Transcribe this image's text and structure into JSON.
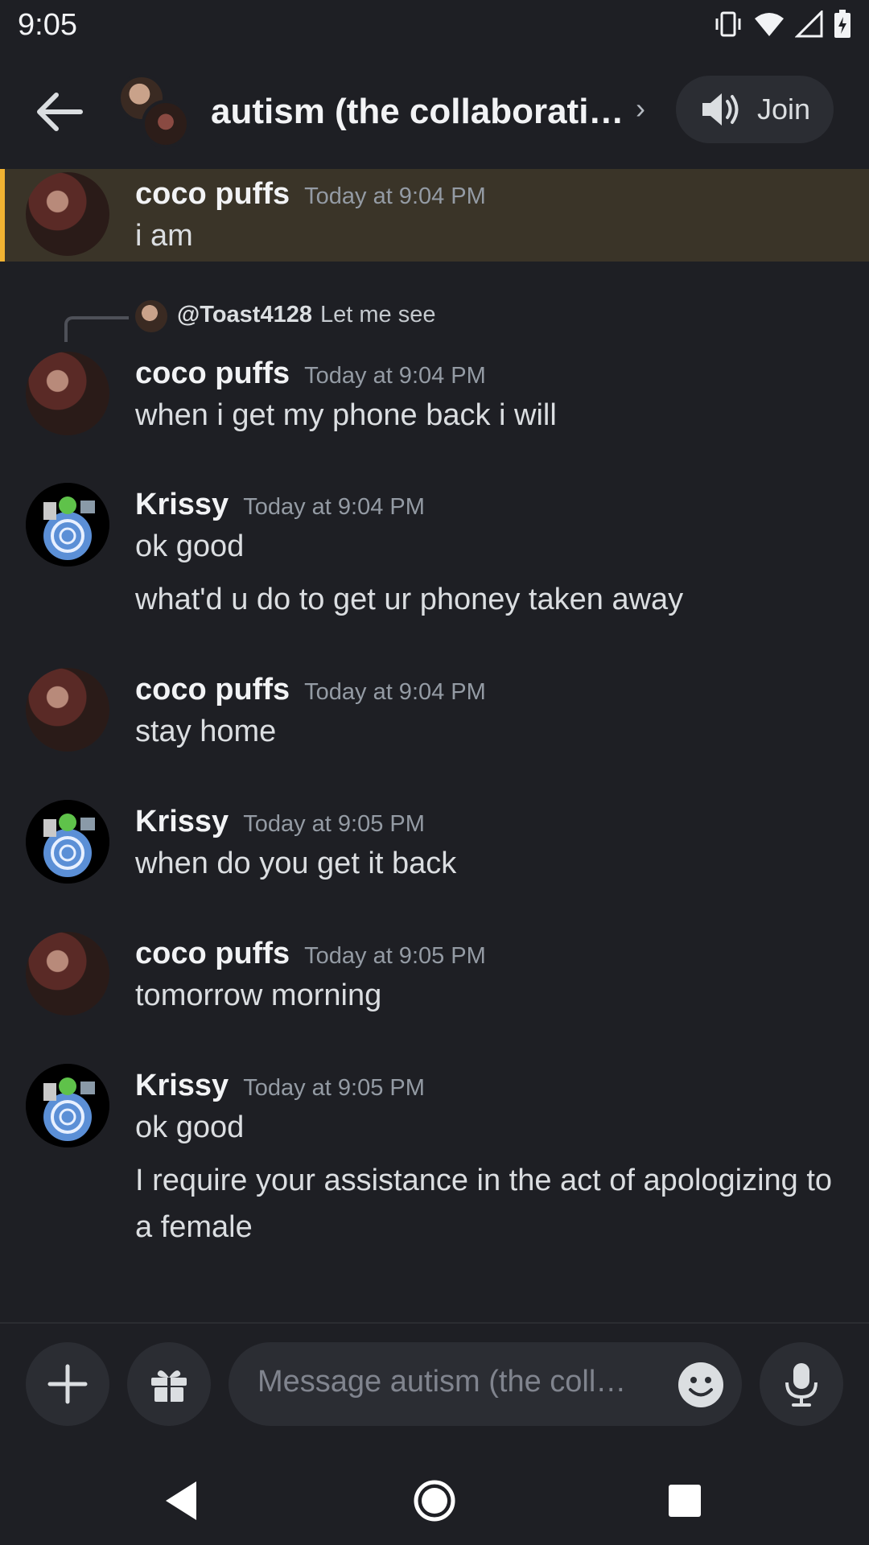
{
  "status_bar": {
    "time": "9:05"
  },
  "header": {
    "channel_title": "autism (the collaborati…",
    "join_label": "Join"
  },
  "messages": [
    {
      "author": "coco puffs",
      "timestamp": "Today at 9:04 PM",
      "lines": [
        "i am"
      ],
      "highlighted": true
    },
    {
      "reply": {
        "user": "@Toast4128",
        "text": "Let me see"
      },
      "author": "coco puffs",
      "timestamp": "Today at 9:04 PM",
      "lines": [
        "when i get my phone back i will"
      ]
    },
    {
      "author": "Krissy",
      "timestamp": "Today at 9:04 PM",
      "lines": [
        "ok good",
        "what'd u do to get ur phoney taken away"
      ]
    },
    {
      "author": "coco puffs",
      "timestamp": "Today at 9:04 PM",
      "lines": [
        "stay home"
      ]
    },
    {
      "author": "Krissy",
      "timestamp": "Today at 9:05 PM",
      "lines": [
        "when do you get it back"
      ]
    },
    {
      "author": "coco puffs",
      "timestamp": "Today at 9:05 PM",
      "lines": [
        "tomorrow morning"
      ]
    },
    {
      "author": "Krissy",
      "timestamp": "Today at 9:05 PM",
      "lines": [
        "ok good",
        "I require your assistance in the act of apologizing to a female"
      ]
    }
  ],
  "composer": {
    "placeholder": "Message autism (the coll…"
  },
  "icons": {
    "back": "arrow-left-icon",
    "speaker": "speaker-icon",
    "plus": "plus-icon",
    "gift": "gift-icon",
    "emoji": "emoji-icon",
    "mic": "microphone-icon"
  },
  "colors": {
    "background": "#1e1f24",
    "highlight_bar": "#f0b232",
    "highlight_bg": "#3a3428"
  }
}
